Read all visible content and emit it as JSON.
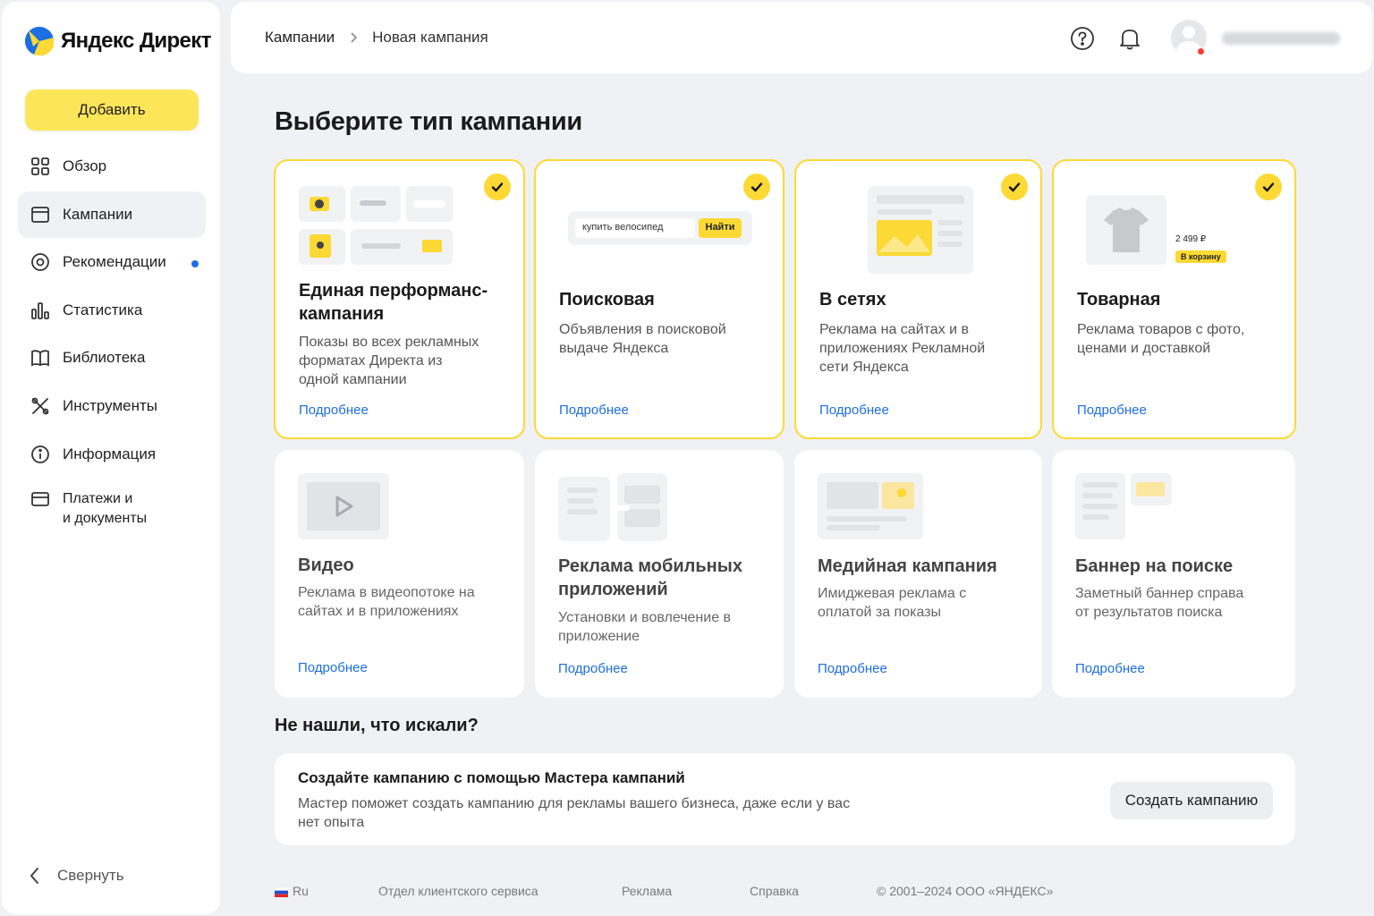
{
  "brand": {
    "name": "Яндекс Директ"
  },
  "sidebar": {
    "add_label": "Добавить",
    "items": [
      {
        "label": "Обзор",
        "icon": "grid-icon"
      },
      {
        "label": "Кампании",
        "icon": "browser-window-icon",
        "active": true
      },
      {
        "label": "Рекомендации",
        "icon": "target-icon",
        "badge_dot": true
      },
      {
        "label": "Статистика",
        "icon": "bar-chart-icon"
      },
      {
        "label": "Библиотека",
        "icon": "book-icon"
      },
      {
        "label": "Инструменты",
        "icon": "tools-icon"
      },
      {
        "label": "Информация",
        "icon": "info-icon"
      },
      {
        "label": "Платежи и\nи документы",
        "icon": "card-icon"
      }
    ],
    "collapse_label": "Свернуть"
  },
  "header": {
    "breadcrumb": [
      "Кампании",
      "Новая кампания"
    ],
    "icons": [
      "help-icon",
      "bell-icon",
      "avatar"
    ]
  },
  "main": {
    "title": "Выберите тип кампании",
    "cards": [
      {
        "title": "Единая перформанс-\nкампания",
        "desc": "Показы во всех рекламных\nформатах Директа из\nодной кампании",
        "link": "Подробнее",
        "selected": true
      },
      {
        "title": "Поисковая",
        "desc": "Объявления в поисковой\nвыдаче Яндекса",
        "link": "Подробнее",
        "selected": true,
        "search_query": "купить велосипед",
        "search_button": "Найти"
      },
      {
        "title": "В сетях",
        "desc": "Реклама на сайтах и в\nприложениях Рекламной\nсети Яндекса",
        "link": "Подробнее",
        "selected": true
      },
      {
        "title": "Товарная",
        "desc": "Реклама товаров с фото,\nценами и доставкой",
        "link": "Подробнее",
        "selected": true,
        "price": "2 499 ₽",
        "cart_label": "В корзину"
      },
      {
        "title": "Видео",
        "desc": "Реклама в видеопотоке на\nсайтах и в приложениях",
        "link": "Подробнее",
        "selected": false
      },
      {
        "title": "Реклама мобильных\nприложений",
        "desc": "Установки и вовлечение в\nприложение",
        "link": "Подробнее",
        "selected": false
      },
      {
        "title": "Медийная кампания",
        "desc": "Имиджевая реклама с\nоплатой за показы",
        "link": "Подробнее",
        "selected": false
      },
      {
        "title": "Баннер на поиске",
        "desc": "Заметный баннер справа\nот результатов поиска",
        "link": "Подробнее",
        "selected": false
      }
    ],
    "not_found_title": "Не нашли, что искали?",
    "wizard": {
      "title": "Создайте кампанию с помощью Мастера кампаний",
      "desc": "Мастер поможет создать кампанию для рекламы вашего бизнеса, даже если у вас нет опыта",
      "button": "Создать кампанию"
    }
  },
  "footer": {
    "lang": "Ru",
    "links": [
      "Отдел клиентского сервиса",
      "Реклама",
      "Справка"
    ],
    "copyright": "© 2001–2024 ООО «ЯНДЕКС»"
  },
  "colors": {
    "accent_yellow": "#fcd934",
    "link_blue": "#1d6ee0",
    "background": "#f0f1f4"
  }
}
